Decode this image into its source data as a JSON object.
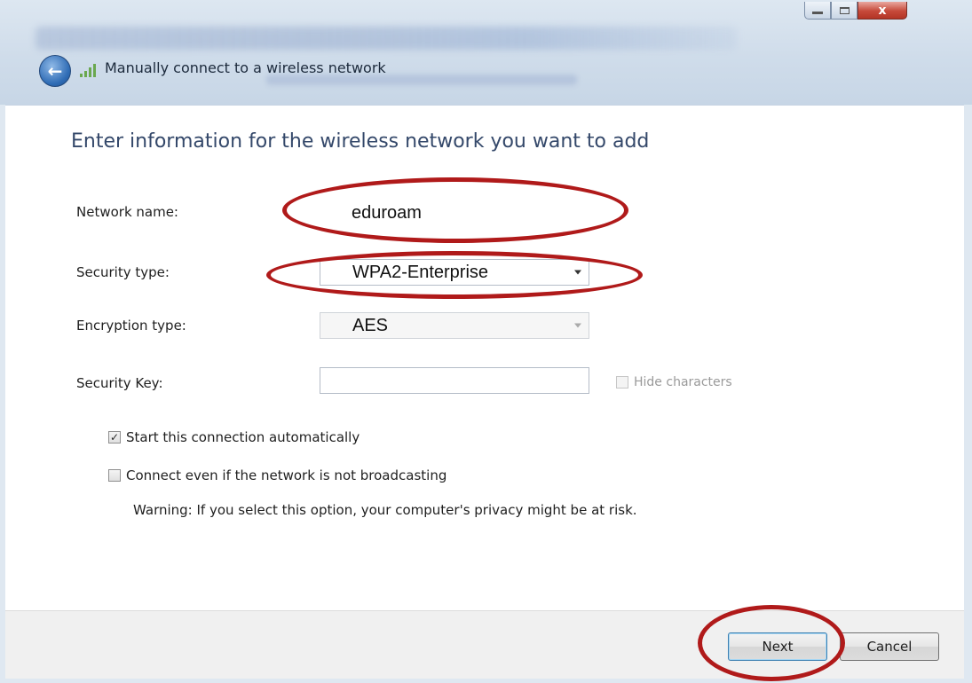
{
  "window": {
    "title": "Manually connect to a wireless network",
    "minimize_icon": "minimize-icon",
    "maximize_icon": "maximize-icon",
    "close_glyph": "x"
  },
  "form": {
    "heading": "Enter information for the wireless network you want to add",
    "network_name": {
      "label": "Network name:",
      "value": "eduroam"
    },
    "security_type": {
      "label": "Security type:",
      "value": "WPA2-Enterprise"
    },
    "encryption_type": {
      "label": "Encryption type:",
      "value": "AES"
    },
    "security_key": {
      "label": "Security Key:",
      "value": ""
    },
    "hide_characters": {
      "label": "Hide characters",
      "checked": false
    },
    "start_automatically": {
      "label": "Start this connection automatically",
      "checked": true
    },
    "connect_even_if_not_broadcasting": {
      "label": "Connect even if the network is not broadcasting",
      "checked": false
    },
    "warning": "Warning: If you select this option, your computer's privacy might be at risk."
  },
  "buttons": {
    "next": "Next",
    "cancel": "Cancel"
  },
  "colors": {
    "annotation": "#b01a1a",
    "heading": "#34486a"
  }
}
